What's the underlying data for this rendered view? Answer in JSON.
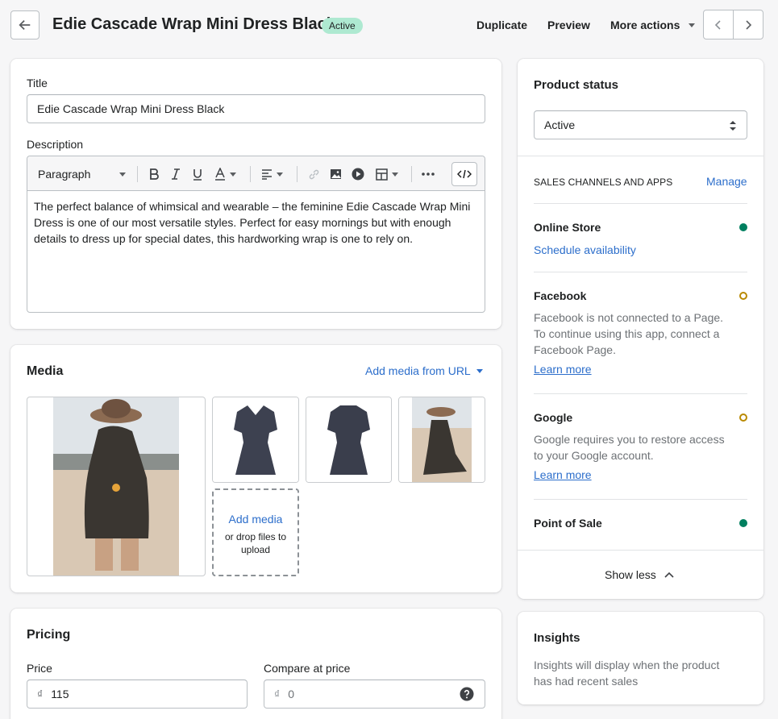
{
  "header": {
    "title": "Edie Cascade Wrap Mini Dress Black",
    "status_badge": "Active",
    "actions": {
      "duplicate": "Duplicate",
      "preview": "Preview",
      "more": "More actions"
    }
  },
  "product": {
    "title_label": "Title",
    "title_value": "Edie Cascade Wrap Mini Dress Black",
    "description_label": "Description",
    "toolbar": {
      "paragraph": "Paragraph"
    },
    "description": "The perfect balance of whimsical and wearable – the feminine Edie Cascade Wrap Mini Dress is one of our most versatile styles. Perfect for easy mornings but with enough details to dress up for special dates, this hardworking wrap is one to rely on."
  },
  "media": {
    "heading": "Media",
    "add_from_url": "Add media from URL",
    "dropzone_title": "Add media",
    "dropzone_hint": "or drop files to upload"
  },
  "pricing": {
    "heading": "Pricing",
    "price_label": "Price",
    "price_currency": "₫",
    "price_value": "115",
    "compare_label": "Compare at price",
    "compare_currency": "₫",
    "compare_value": "0"
  },
  "status_card": {
    "heading": "Product status",
    "selected": "Active",
    "channels_heading": "SALES CHANNELS AND APPS",
    "manage": "Manage",
    "channels": [
      {
        "name": "Online Store",
        "link": "Schedule availability",
        "status": "active"
      },
      {
        "name": "Facebook",
        "description": "Facebook is not connected to a Page. To continue using this app, connect a Facebook Page.",
        "link": "Learn more",
        "status": "pending"
      },
      {
        "name": "Google",
        "description": "Google requires you to restore access to your Google account.",
        "link": "Learn more",
        "status": "pending"
      },
      {
        "name": "Point of Sale",
        "status": "active"
      }
    ],
    "show_less": "Show less"
  },
  "insights": {
    "heading": "Insights",
    "text": "Insights will display when the product has had recent sales"
  },
  "colors": {
    "active_badge": "#aee9d1",
    "link": "#2c6ecb",
    "online": "#007f5f",
    "pending": "#b98900"
  }
}
